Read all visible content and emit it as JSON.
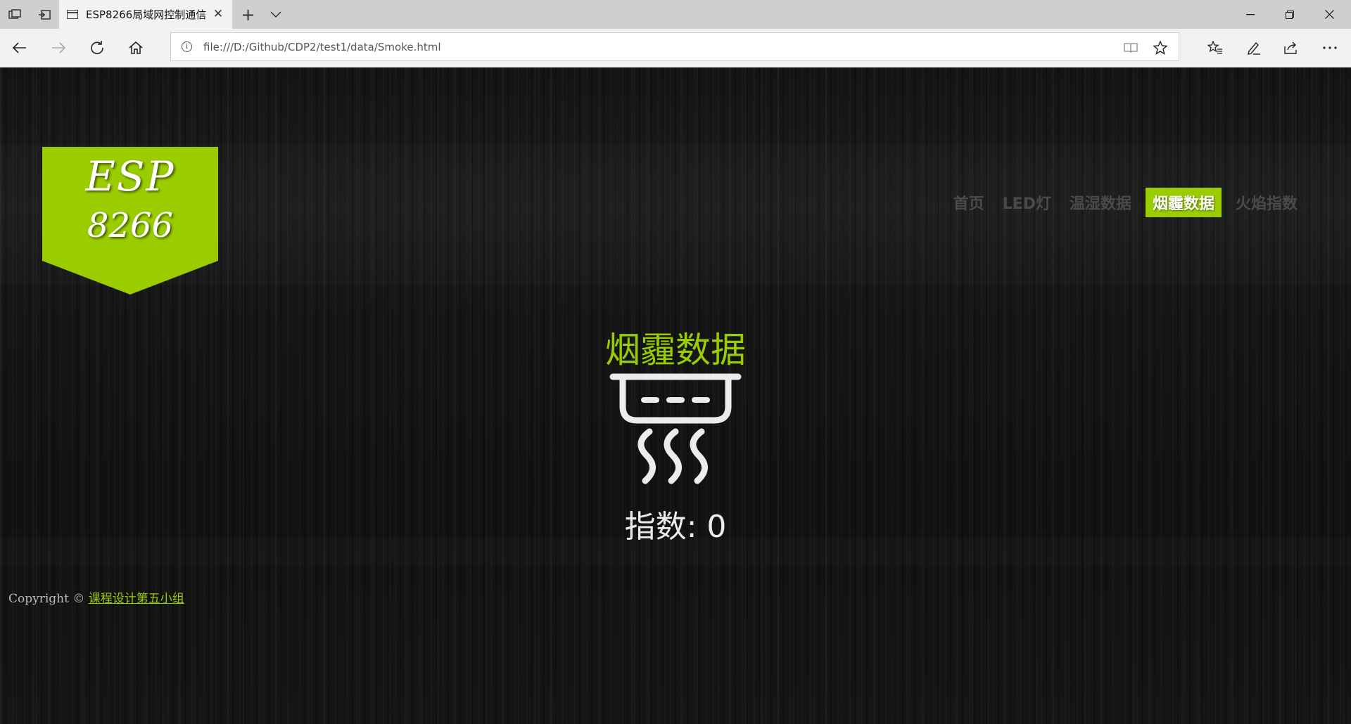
{
  "browser": {
    "tab_title": "ESP8266局域网控制通信",
    "tab_close": "✕",
    "new_tab": "+",
    "tab_list": "⌄",
    "url": "file:///D:/Github/CDP2/test1/data/Smoke.html",
    "url_info": "i"
  },
  "logo": {
    "line1": "ESP",
    "line2": "8266",
    "color": "#9acd00"
  },
  "nav": {
    "items": [
      {
        "label": "首页"
      },
      {
        "label": "LED灯"
      },
      {
        "label": "温湿数据"
      },
      {
        "label": "烟霾数据",
        "active": true
      },
      {
        "label": "火焰指数"
      }
    ]
  },
  "main": {
    "title": "烟霾数据",
    "icon": "smoke-detector-icon",
    "reading": "指数: 0"
  },
  "footer": {
    "copyright": "Copyright ©",
    "link": "课程设计第五小组"
  }
}
